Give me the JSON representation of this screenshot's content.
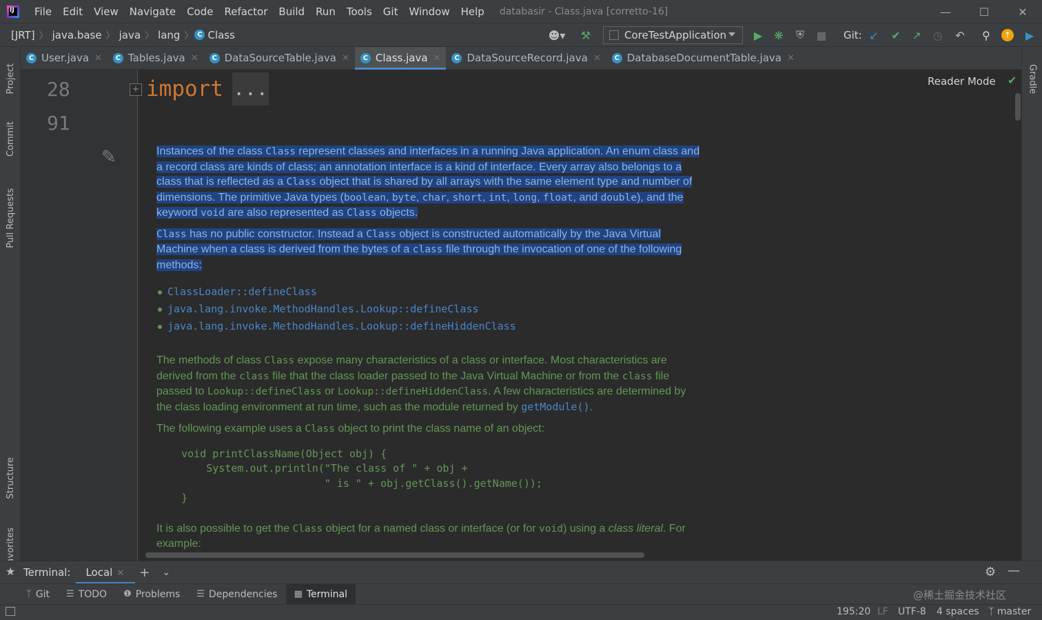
{
  "menubar": {
    "logo_text": "IJ",
    "items": [
      "File",
      "Edit",
      "View",
      "Navigate",
      "Code",
      "Refactor",
      "Build",
      "Run",
      "Tools",
      "Git",
      "Window",
      "Help"
    ],
    "window_title": "databasir - Class.java [corretto-16]"
  },
  "breadcrumb": {
    "items": [
      "[JRT]",
      "java.base",
      "java",
      "lang",
      "Class"
    ]
  },
  "toolbar": {
    "run_config": "CoreTestApplication",
    "git_label": "Git:"
  },
  "tabs": [
    {
      "label": "User.java",
      "active": false
    },
    {
      "label": "Tables.java",
      "active": false
    },
    {
      "label": "DataSourceTable.java",
      "active": false
    },
    {
      "label": "Class.java",
      "active": true
    },
    {
      "label": "DataSourceRecord.java",
      "active": false
    },
    {
      "label": "DatabaseDocumentTable.java",
      "active": false
    }
  ],
  "left_tools": [
    "Project",
    "Commit",
    "Pull Requests",
    "Structure",
    "Favorites"
  ],
  "right_tools": [
    "Gradle"
  ],
  "editor": {
    "line_numbers": [
      "28",
      "91"
    ],
    "import_keyword": "import",
    "import_folded": "...",
    "reader_mode": "Reader Mode"
  },
  "doc": {
    "methods": [
      "ClassLoader::defineClass",
      "java.lang.invoke.MethodHandles.Lookup::defineClass",
      "java.lang.invoke.MethodHandles.Lookup::defineHiddenClass"
    ],
    "code_example": "    void printClassName(Object obj) {\n        System.out.println(\"The class of \" + obj +\n                           \" is \" + obj.getClass().getName());\n    }"
  },
  "terminal": {
    "label": "Terminal:",
    "tab": "Local"
  },
  "tool_tabs": [
    {
      "label": "Git",
      "icon": "git-branch-icon"
    },
    {
      "label": "TODO",
      "icon": "list-icon"
    },
    {
      "label": "Problems",
      "icon": "info-icon"
    },
    {
      "label": "Dependencies",
      "icon": "layers-icon"
    },
    {
      "label": "Terminal",
      "icon": "terminal-icon"
    }
  ],
  "watermark": "@稀土掘金技术社区",
  "status": {
    "position": "195:20",
    "line_sep": "LF",
    "encoding": "UTF-8",
    "indent": "4 spaces",
    "branch": "master"
  },
  "colors": {
    "accent": "#4a88c7",
    "doc_text": "#629755",
    "selection": "#214283",
    "keyword": "#cc7832"
  }
}
